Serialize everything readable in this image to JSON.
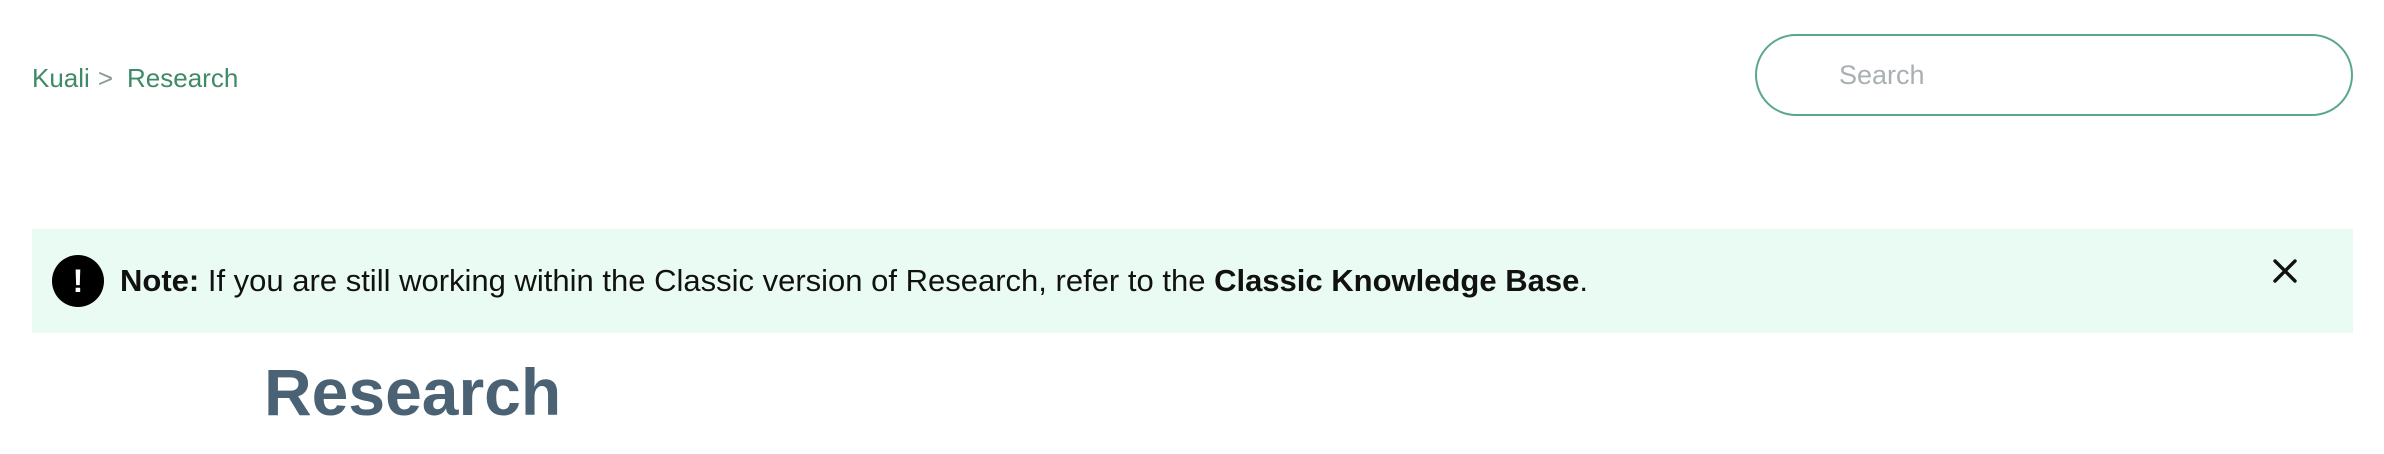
{
  "breadcrumb": {
    "items": [
      "Kuali",
      "Research"
    ],
    "separator": ">"
  },
  "search": {
    "placeholder": "Search",
    "value": ""
  },
  "note": {
    "label": "Note:",
    "text": "If you are still working within the Classic version of Research, refer to the",
    "link_text": "Classic Knowledge Base",
    "trailing": ".",
    "icon": "exclamation-icon",
    "close_icon": "close-icon",
    "background": "#e9fbf3"
  },
  "page": {
    "title": "Research"
  },
  "colors": {
    "accent": "#3f8a68",
    "search_border": "#5aa888",
    "title": "#4a6274"
  }
}
